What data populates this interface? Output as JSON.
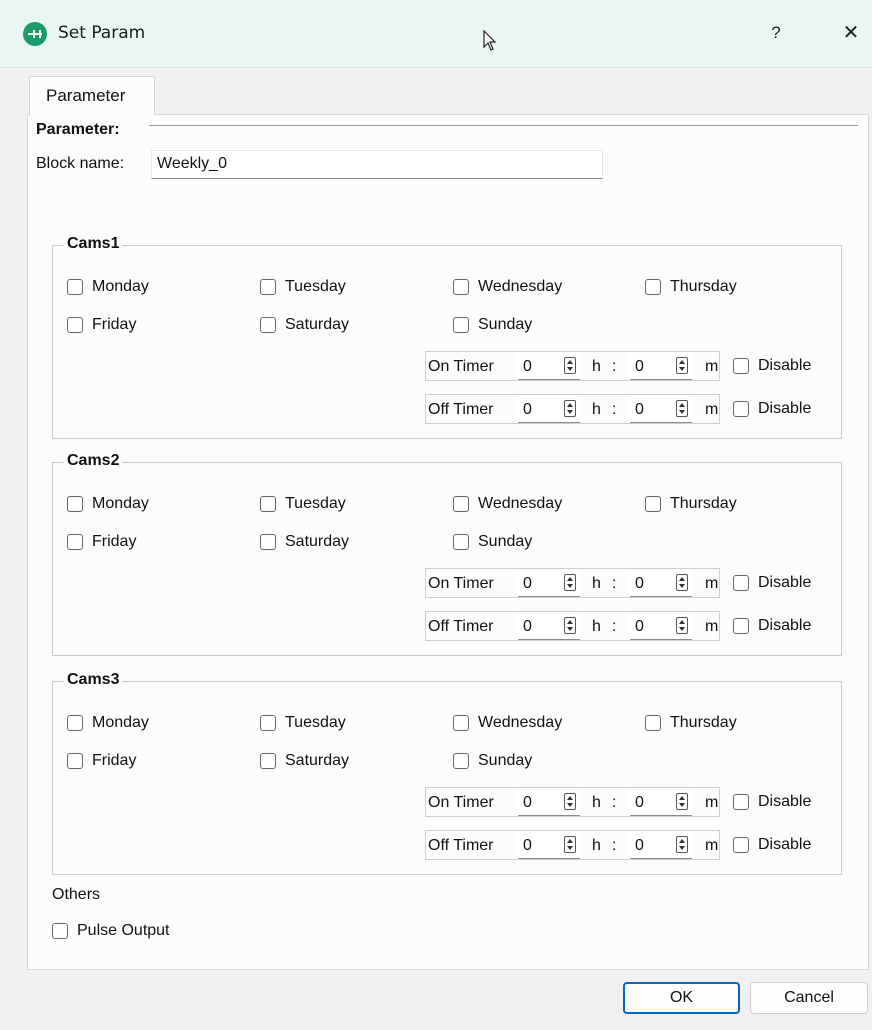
{
  "window": {
    "title": "Set Param",
    "help": "?",
    "close": "✕"
  },
  "tab": "Parameter",
  "parameter": {
    "heading": "Parameter:",
    "block_label": "Block name:",
    "block_value": "Weekly_0"
  },
  "days_row1": [
    "Monday",
    "Tuesday",
    "Wednesday",
    "Thursday"
  ],
  "days_row2": [
    "Friday",
    "Saturday",
    "Sunday"
  ],
  "cams": [
    {
      "title": "Cams1"
    },
    {
      "title": "Cams2"
    },
    {
      "title": "Cams3"
    }
  ],
  "timers": {
    "on_label": "On Timer",
    "off_label": "Off Timer",
    "hours": "0",
    "minutes": "0",
    "h_unit": "h",
    "sep": ":",
    "m_unit": "m",
    "disable": "Disable"
  },
  "others": {
    "heading": "Others",
    "pulse": "Pulse Output"
  },
  "buttons": {
    "ok": "OK",
    "cancel": "Cancel"
  },
  "colors": {
    "titlebar": "#e9f6f4",
    "app_icon": "#1a9b6a",
    "ok_border": "#0067c0"
  }
}
